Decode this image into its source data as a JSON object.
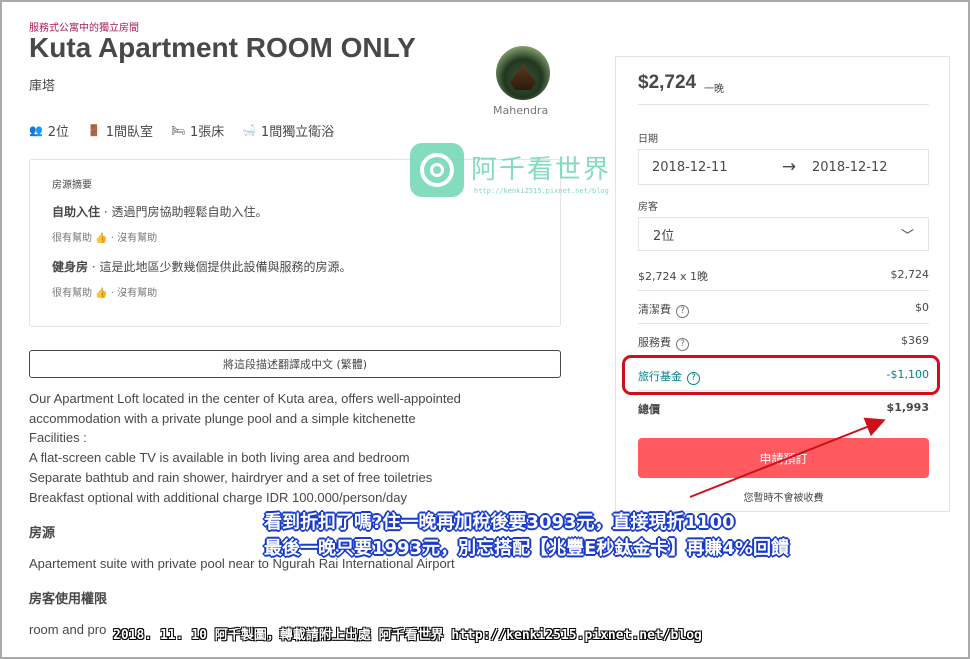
{
  "listing": {
    "category": "服務式公寓中的獨立房間",
    "title": "Kuta Apartment ROOM ONLY",
    "location": "庫塔",
    "host_name": "Mahendra",
    "amenities": [
      {
        "icon": "guests-icon",
        "glyph": "👥",
        "label": "2位"
      },
      {
        "icon": "door-icon",
        "glyph": "🚪",
        "label": "1間臥室"
      },
      {
        "icon": "bed-icon",
        "glyph": "🛏",
        "label": "1張床"
      },
      {
        "icon": "bath-icon",
        "glyph": "🛁",
        "label": "1間獨立衛浴"
      }
    ]
  },
  "summary": {
    "header": "房源摘要",
    "items": [
      {
        "title": "自助入住",
        "text": " · 透過門房協助輕鬆自助入住。",
        "helpful": "很有幫助 👍 · 沒有幫助"
      },
      {
        "title": "健身房",
        "text": " · 這是此地區少數幾個提供此設備與服務的房源。",
        "helpful": "很有幫助 👍 · 沒有幫助"
      }
    ]
  },
  "translate_button": "將這段描述翻譯成中文 (繁體)",
  "description": [
    "Our Apartment Loft located in the center of Kuta area, offers well-appointed",
    "accommodation with a private plunge pool and a simple kitchenette",
    "Facilities :",
    "A flat-screen cable TV is available in both living area and bedroom",
    "Separate bathtub and rain shower, hairdryer and a set of free toiletries",
    "Breakfast optional with additional charge IDR 100.000/person/day"
  ],
  "sections": {
    "listing_heading": "房源",
    "listing_text": "Apartement suite with private pool near to Ngurah Rai International Airport",
    "access_heading": "房客使用權限",
    "access_text": "room and pro"
  },
  "booking": {
    "price": "$2,724",
    "per_night": "一晚",
    "dates_label": "日期",
    "checkin": "2018-12-11",
    "arrow": "→",
    "checkout": "2018-12-12",
    "guests_label": "房客",
    "guests_value": "2位",
    "chevron": "﹀",
    "rows": [
      {
        "label": "$2,724 x 1晚",
        "value": "$2,724"
      },
      {
        "label": "清潔費",
        "value": "$0"
      },
      {
        "label": "服務費",
        "value": "$369"
      }
    ],
    "travel_credit_label": "旅行基金",
    "travel_credit_value": "-$1,100",
    "total_label": "總價",
    "total_value": "$1,993",
    "request_button": "申請預訂",
    "no_charge": "您暫時不會被收費",
    "help_glyph": "?"
  },
  "annotations": {
    "line1": "看到折扣了嗎?住一晚再加稅後要3093元，直接現折1100",
    "line2": "最後一晚只要1993元，別忘搭配【兆豐E秒鈦金卡】再賺4%回饋",
    "credit": "2018. 11. 10 阿千製圖，轉載請附上出處 阿千看世界 http://kenki2515.pixnet.net/blog"
  },
  "watermark": {
    "name": "阿千看世界",
    "url": "http://kenki2515.pixnet.net/blog"
  },
  "colors": {
    "accent": "#ff5a5f",
    "teal": "#008489",
    "highlight": "#d00f1c",
    "annotation_stroke": "#1a3cc8"
  }
}
